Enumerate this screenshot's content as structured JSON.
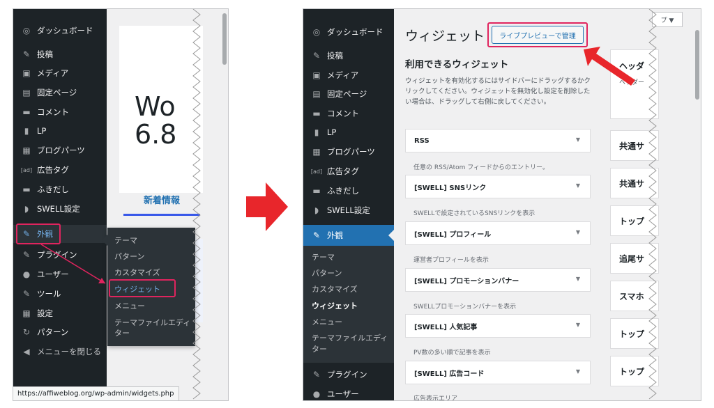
{
  "left_panel": {
    "menu": [
      {
        "icon": "dashboard-icon",
        "glyph": "◎",
        "label": "ダッシュボード"
      },
      {
        "icon": "pin-icon",
        "glyph": "✎",
        "label": "投稿"
      },
      {
        "icon": "media-icon",
        "glyph": "▣",
        "label": "メディア"
      },
      {
        "icon": "page-icon",
        "glyph": "▤",
        "label": "固定ページ"
      },
      {
        "icon": "comment-icon",
        "glyph": "▬",
        "label": "コメント"
      },
      {
        "icon": "file-icon",
        "glyph": "▮",
        "label": "LP"
      },
      {
        "icon": "blocks-icon",
        "glyph": "▦",
        "label": "ブログパーツ"
      },
      {
        "icon": "ad-icon",
        "glyph": "[ad]",
        "label": "広告タグ"
      },
      {
        "icon": "balloon-icon",
        "glyph": "▬",
        "label": "ふきだし"
      },
      {
        "icon": "swell-icon",
        "glyph": "◗",
        "label": "SWELL設定"
      },
      {
        "icon": "appearance-icon",
        "glyph": "✎",
        "label": "外観"
      },
      {
        "icon": "plugin-icon",
        "glyph": "✎",
        "label": "プラグイン"
      },
      {
        "icon": "user-icon",
        "glyph": "●",
        "label": "ユーザー"
      },
      {
        "icon": "tool-icon",
        "glyph": "✎",
        "label": "ツール"
      },
      {
        "icon": "settings-icon",
        "glyph": "▦",
        "label": "設定"
      },
      {
        "icon": "pattern-icon",
        "glyph": "↻",
        "label": "パターン"
      },
      {
        "icon": "collapse-icon",
        "glyph": "◀",
        "label": "メニューを閉じる"
      }
    ],
    "flyout": [
      "テーマ",
      "パターン",
      "カスタマイズ",
      "ウィジェット",
      "メニュー",
      "テーマファイルエディ",
      "ター"
    ],
    "welcome_line1": "Wo",
    "welcome_line2": "6.8",
    "news_tab": "新着情報",
    "status_url": "https://affiweblog.org/wp-admin/widgets.php"
  },
  "right_panel": {
    "menu_top": [
      {
        "icon": "dashboard-icon",
        "glyph": "◎",
        "label": "ダッシュボード"
      },
      {
        "icon": "pin-icon",
        "glyph": "✎",
        "label": "投稿"
      },
      {
        "icon": "media-icon",
        "glyph": "▣",
        "label": "メディア"
      },
      {
        "icon": "page-icon",
        "glyph": "▤",
        "label": "固定ページ"
      },
      {
        "icon": "comment-icon",
        "glyph": "▬",
        "label": "コメント"
      },
      {
        "icon": "file-icon",
        "glyph": "▮",
        "label": "LP"
      },
      {
        "icon": "blocks-icon",
        "glyph": "▦",
        "label": "ブログパーツ"
      },
      {
        "icon": "ad-icon",
        "glyph": "[ad]",
        "label": "広告タグ"
      },
      {
        "icon": "balloon-icon",
        "glyph": "▬",
        "label": "ふきだし"
      },
      {
        "icon": "swell-icon",
        "glyph": "◗",
        "label": "SWELL設定"
      }
    ],
    "active_item": {
      "glyph": "✎",
      "label": "外観"
    },
    "submenu": [
      "テーマ",
      "パターン",
      "カスタマイズ",
      "ウィジェット",
      "メニュー",
      "テーマファイルエディ",
      "ター"
    ],
    "menu_bottom": [
      {
        "icon": "plugin-icon",
        "glyph": "✎",
        "label": "プラグイン"
      },
      {
        "icon": "user-icon",
        "glyph": "●",
        "label": "ユーザー"
      }
    ],
    "page_title": "ウィジェット",
    "live_preview_button": "ライブプレビューで管理",
    "dropdown_tab": "プ ▼",
    "available_title": "利用できるウィジェット",
    "available_desc": "ウィジェットを有効化するにはサイドバーにドラッグするかクリックしてください。ウィジェットを無効化し設定を削除したい場合は、ドラッグして右側に戻してください。",
    "widgets": [
      {
        "name": "RSS",
        "desc": "任意の RSS/Atom フィードからのエントリー。"
      },
      {
        "name": "[SWELL] SNSリンク",
        "desc": "SWELLで設定されているSNSリンクを表示"
      },
      {
        "name": "[SWELL] プロフィール",
        "desc": "運営者プロフィールを表示"
      },
      {
        "name": "[SWELL] プロモーションバナー",
        "desc": "SWELLプロモーションバナーを表示"
      },
      {
        "name": "[SWELL] 人気記事",
        "desc": "PV数の多い順で記事を表示"
      },
      {
        "name": "[SWELL] 広告コード",
        "desc": "広告表示エリア"
      }
    ],
    "areas": [
      {
        "name": "ヘッダ",
        "sub": "ヘッダー"
      },
      {
        "name": "共通サ"
      },
      {
        "name": "共通サ"
      },
      {
        "name": "トップ"
      },
      {
        "name": "追尾サ"
      },
      {
        "name": "スマホ"
      },
      {
        "name": "トップ"
      },
      {
        "name": "トップ"
      }
    ],
    "chevron": "▼"
  },
  "colors": {
    "sidebar": "#1d2327",
    "active": "#2271b1",
    "highlight": "#e0245e",
    "arrow": "#e8262b"
  }
}
